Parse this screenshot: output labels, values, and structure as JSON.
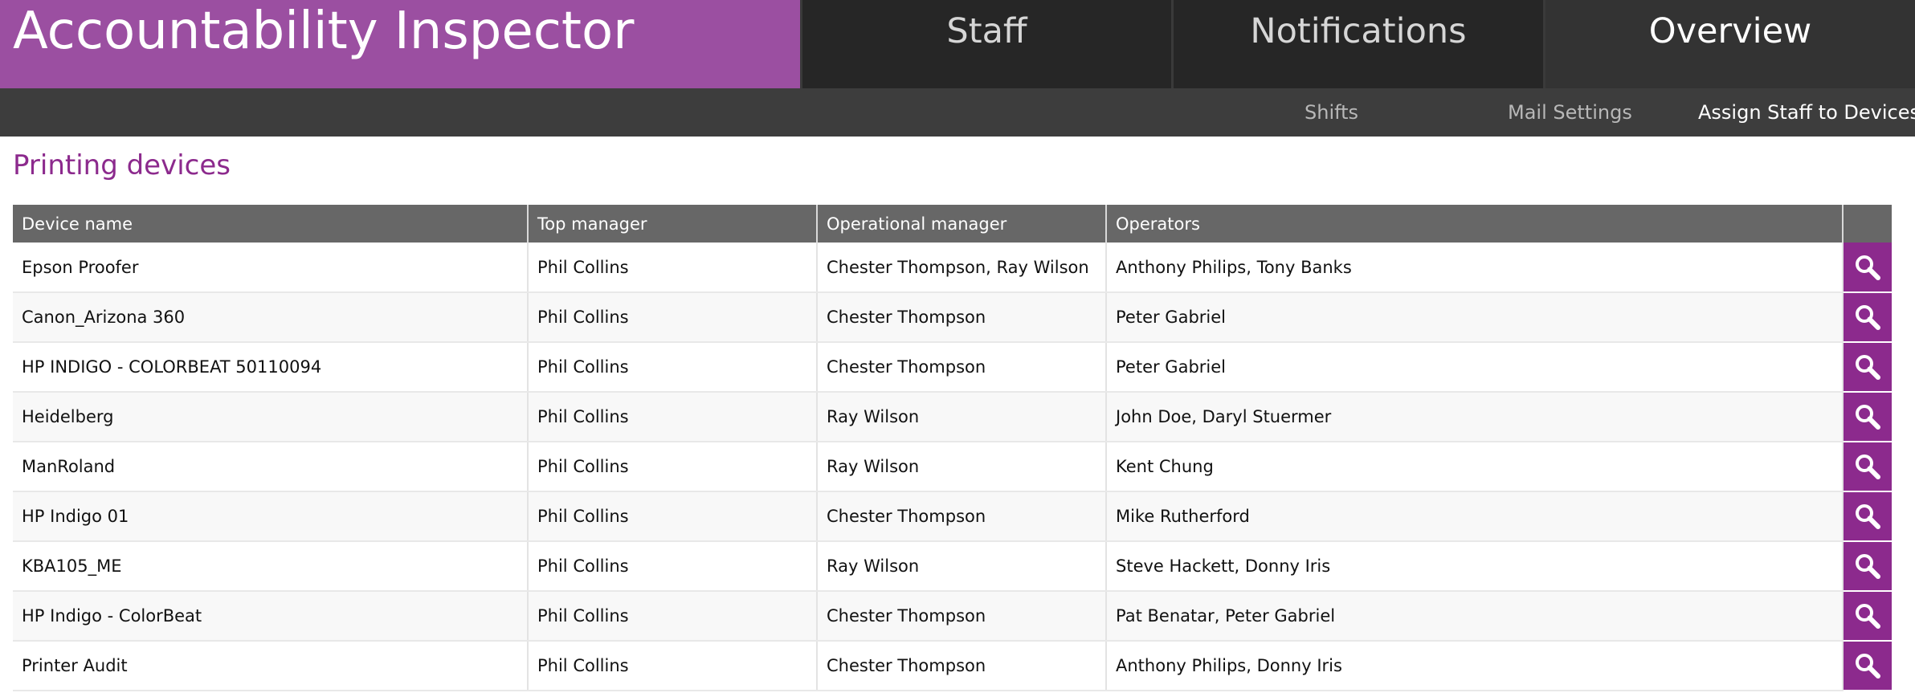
{
  "app": {
    "title": "Accountability Inspector"
  },
  "nav": {
    "tabs": [
      {
        "label": "Staff"
      },
      {
        "label": "Notifications"
      },
      {
        "label": "Overview"
      }
    ],
    "active_tab": "Overview",
    "subnav": [
      {
        "label": "Shifts"
      },
      {
        "label": "Mail Settings"
      },
      {
        "label": "Assign Staff to Devices"
      }
    ],
    "active_subnav": "Assign Staff to Devices"
  },
  "main": {
    "title": "Printing devices",
    "table": {
      "columns": [
        "Device name",
        "Top manager",
        "Operational manager",
        "Operators",
        ""
      ],
      "rows": [
        {
          "device": "Epson Proofer",
          "top_manager": "Phil Collins",
          "op_manager": "Chester Thompson, Ray Wilson",
          "operators": "Anthony Philips, Tony Banks"
        },
        {
          "device": "Canon_Arizona 360",
          "top_manager": "Phil Collins",
          "op_manager": "Chester Thompson",
          "operators": "Peter Gabriel"
        },
        {
          "device": "HP INDIGO - COLORBEAT 50110094",
          "top_manager": "Phil Collins",
          "op_manager": "Chester Thompson",
          "operators": "Peter Gabriel"
        },
        {
          "device": "Heidelberg",
          "top_manager": "Phil Collins",
          "op_manager": "Ray Wilson",
          "operators": "John Doe, Daryl Stuermer"
        },
        {
          "device": "ManRoland",
          "top_manager": "Phil Collins",
          "op_manager": "Ray Wilson",
          "operators": "Kent Chung"
        },
        {
          "device": "HP Indigo 01",
          "top_manager": "Phil Collins",
          "op_manager": "Chester Thompson",
          "operators": "Mike Rutherford"
        },
        {
          "device": "KBA105_ME",
          "top_manager": "Phil Collins",
          "op_manager": "Ray Wilson",
          "operators": "Steve Hackett, Donny Iris"
        },
        {
          "device": "HP Indigo - ColorBeat",
          "top_manager": "Phil Collins",
          "op_manager": "Chester Thompson",
          "operators": "Pat Benatar, Peter Gabriel"
        },
        {
          "device": "Printer Audit",
          "top_manager": "Phil Collins",
          "op_manager": "Chester Thompson",
          "operators": "Anthony Philips, Donny Iris"
        }
      ],
      "row_action_icon": "search-icon"
    }
  },
  "colors": {
    "brand": "#9b4fa1",
    "accent": "#8c2a8d",
    "nav_bg": "#262626",
    "subnav_bg": "#3d3d3d",
    "table_header_bg": "#676767"
  }
}
